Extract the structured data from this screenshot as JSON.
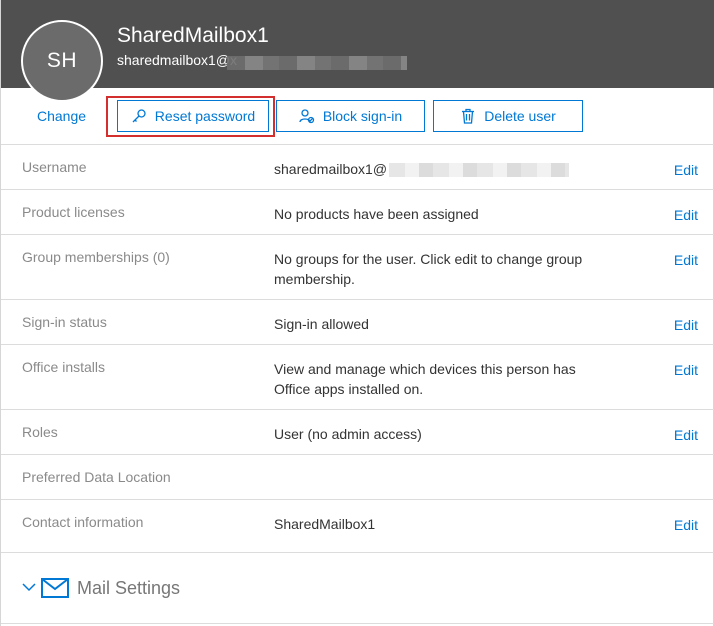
{
  "header": {
    "avatar_initials": "SH",
    "display_name": "SharedMailbox1",
    "email_prefix": "sharedmailbox1@x"
  },
  "toolbar": {
    "change_label": "Change",
    "reset_password_label": "Reset password",
    "block_signin_label": "Block sign-in",
    "delete_user_label": "Delete user"
  },
  "rows": [
    {
      "label": "Username",
      "value": "sharedmailbox1@",
      "edit": "Edit"
    },
    {
      "label": "Product licenses",
      "value": "No products have been assigned",
      "edit": "Edit"
    },
    {
      "label": "Group memberships (0)",
      "value": "No groups for the user. Click edit to change group membership.",
      "edit": "Edit"
    },
    {
      "label": "Sign-in status",
      "value": "Sign-in allowed",
      "edit": "Edit"
    },
    {
      "label": "Office installs",
      "value": "View and manage which devices this person has Office apps installed on.",
      "edit": "Edit"
    },
    {
      "label": "Roles",
      "value": "User (no admin access)",
      "edit": "Edit"
    },
    {
      "label": "Preferred Data Location",
      "value": "",
      "edit": ""
    },
    {
      "label": "Contact information",
      "value": "SharedMailbox1",
      "edit": "Edit"
    }
  ],
  "mail_settings": {
    "label": "Mail Settings"
  },
  "colors": {
    "accent": "#0078d4",
    "header_bg": "#505050",
    "highlight": "#d32f2f"
  }
}
